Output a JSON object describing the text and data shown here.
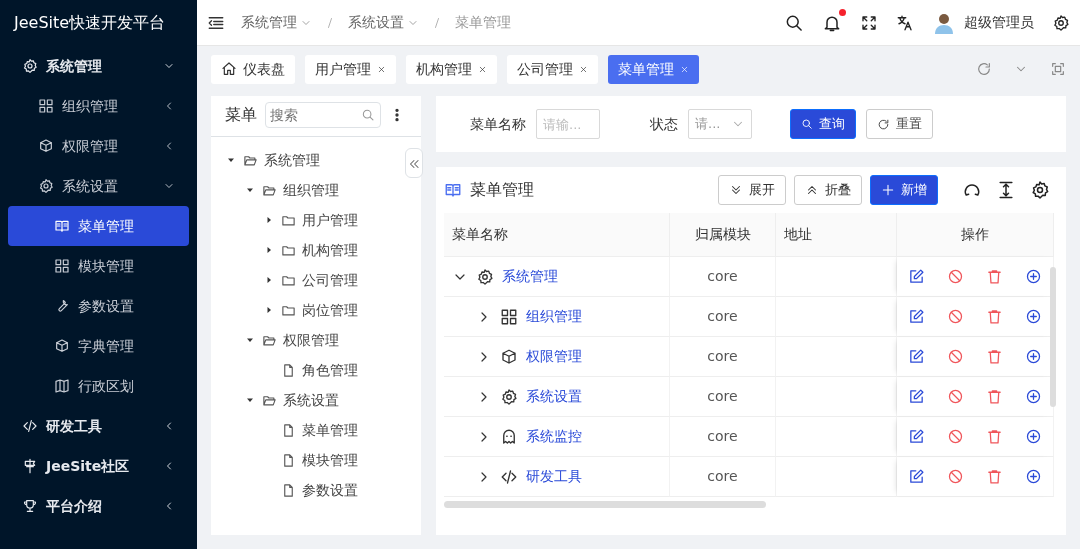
{
  "app_title": "JeeSite快速开发平台",
  "sidebar": {
    "items": [
      {
        "label": "系统管理",
        "expanded": true,
        "children": [
          {
            "label": "组织管理",
            "expanded": false
          },
          {
            "label": "权限管理",
            "expanded": false
          },
          {
            "label": "系统设置",
            "expanded": true,
            "children": [
              {
                "label": "菜单管理",
                "selected": true
              },
              {
                "label": "模块管理",
                "selected": false
              },
              {
                "label": "参数设置",
                "selected": false
              },
              {
                "label": "字典管理",
                "selected": false
              },
              {
                "label": "行政区划",
                "selected": false
              }
            ]
          }
        ]
      },
      {
        "label": "研发工具",
        "expanded": false
      },
      {
        "label": "JeeSite社区",
        "expanded": false
      },
      {
        "label": "平台介绍",
        "expanded": false
      }
    ]
  },
  "breadcrumb": [
    {
      "label": "系统管理",
      "dropdown": true
    },
    {
      "label": "系统设置",
      "dropdown": true
    },
    {
      "label": "菜单管理",
      "dropdown": false
    }
  ],
  "header": {
    "notifications_unread": true,
    "user": "超级管理员"
  },
  "tabs": [
    {
      "label": "仪表盘",
      "closable": false,
      "selected": false
    },
    {
      "label": "用户管理",
      "closable": true,
      "selected": false
    },
    {
      "label": "机构管理",
      "closable": true,
      "selected": false
    },
    {
      "label": "公司管理",
      "closable": true,
      "selected": false
    },
    {
      "label": "菜单管理",
      "closable": true,
      "selected": true
    }
  ],
  "tree": {
    "title": "菜单",
    "search": {
      "placeholder": "搜索"
    },
    "nodes": [
      {
        "label": "系统管理",
        "kind": "folder",
        "expanded": true,
        "children": [
          {
            "label": "组织管理",
            "kind": "folder",
            "expanded": true,
            "children": [
              {
                "label": "用户管理",
                "kind": "folder",
                "expanded": false
              },
              {
                "label": "机构管理",
                "kind": "folder",
                "expanded": false
              },
              {
                "label": "公司管理",
                "kind": "folder",
                "expanded": false
              },
              {
                "label": "岗位管理",
                "kind": "folder",
                "expanded": false
              }
            ]
          },
          {
            "label": "权限管理",
            "kind": "folder",
            "expanded": true,
            "children": [
              {
                "label": "角色管理",
                "kind": "file"
              }
            ]
          },
          {
            "label": "系统设置",
            "kind": "folder",
            "expanded": true,
            "children": [
              {
                "label": "菜单管理",
                "kind": "file"
              },
              {
                "label": "模块管理",
                "kind": "file"
              },
              {
                "label": "参数设置",
                "kind": "file"
              }
            ]
          }
        ]
      }
    ]
  },
  "filters": [
    {
      "label": "菜单名称",
      "kind": "text",
      "placeholder": "请输..."
    },
    {
      "label": "状态",
      "kind": "select",
      "placeholder": "请..."
    }
  ],
  "filter_buttons": [
    {
      "label": "查询",
      "kind": "primary"
    },
    {
      "label": "重置",
      "kind": "default"
    }
  ],
  "table": {
    "title": "菜单管理",
    "actions": [
      {
        "label": "展开",
        "kind": "expand"
      },
      {
        "label": "折叠",
        "kind": "collapse"
      },
      {
        "label": "新增",
        "kind": "add"
      }
    ],
    "columns": [
      "菜单名称",
      "归属模块",
      "地址",
      "操作"
    ],
    "rows": [
      {
        "name": "系统管理",
        "module": "core",
        "expanded": true,
        "children": [
          {
            "name": "组织管理",
            "module": "core",
            "expanded": false
          },
          {
            "name": "权限管理",
            "module": "core",
            "expanded": false
          },
          {
            "name": "系统设置",
            "module": "core",
            "expanded": false
          },
          {
            "name": "系统监控",
            "module": "core",
            "expanded": false
          },
          {
            "name": "研发工具",
            "module": "core",
            "expanded": false
          }
        ]
      }
    ]
  }
}
